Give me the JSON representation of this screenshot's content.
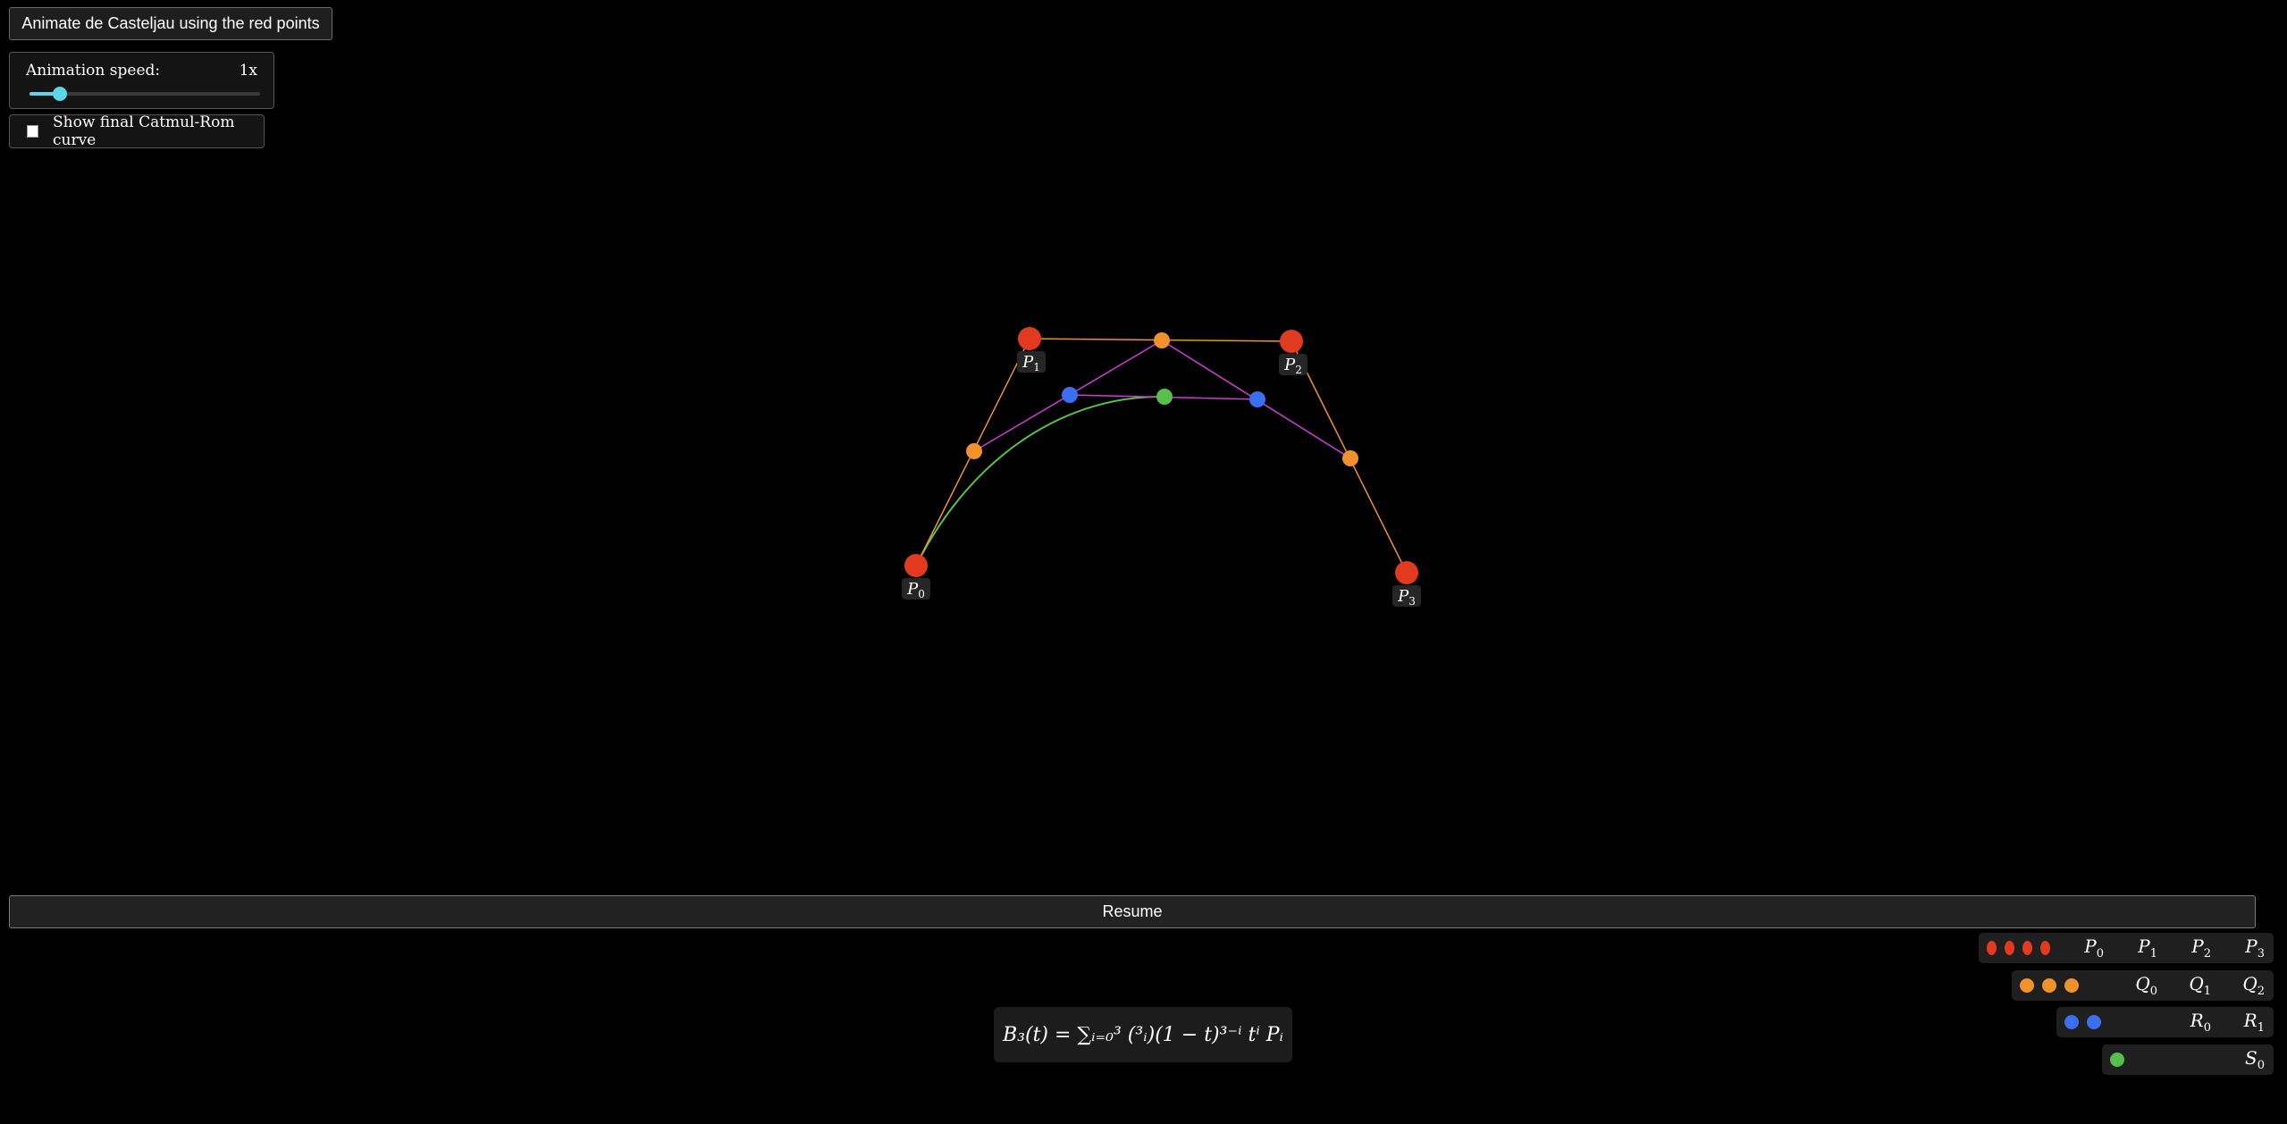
{
  "controls": {
    "animate_button_label": "Animate de Casteljau using the red points",
    "speed_label": "Animation speed:",
    "speed_value": "1x",
    "speed_slider_fraction": 0.13,
    "catmull_checkbox_label": "Show final Catmul-Rom curve",
    "catmull_checked": false,
    "resume_button_label": "Resume"
  },
  "formula": "B₃(t) = ∑ᵢ₌₀³ (³ᵢ)(1 − t)³⁻ⁱ tⁱ Pᵢ",
  "control_points": [
    {
      "name": "P",
      "sub": "0"
    },
    {
      "name": "P",
      "sub": "1"
    },
    {
      "name": "P",
      "sub": "2"
    },
    {
      "name": "P",
      "sub": "3"
    }
  ],
  "legend": [
    {
      "color": "#e23a1e",
      "count": 4,
      "labels": [
        "P",
        "P",
        "P",
        "P"
      ],
      "subs": [
        "0",
        "1",
        "2",
        "3"
      ]
    },
    {
      "color": "#f0922b",
      "count": 3,
      "labels": [
        "Q",
        "Q",
        "Q"
      ],
      "subs": [
        "0",
        "1",
        "2"
      ]
    },
    {
      "color": "#3c6ff0",
      "count": 2,
      "labels": [
        "R",
        "R"
      ],
      "subs": [
        "0",
        "1"
      ]
    },
    {
      "color": "#56c04a",
      "count": 1,
      "labels": [
        "S"
      ],
      "subs": [
        "0"
      ]
    }
  ],
  "colors": {
    "red": "#e23a1e",
    "orange": "#f0922b",
    "blue": "#3c6ff0",
    "green": "#56c04a",
    "magenta": "#d23ad8",
    "accent": "#5fd6e6"
  }
}
